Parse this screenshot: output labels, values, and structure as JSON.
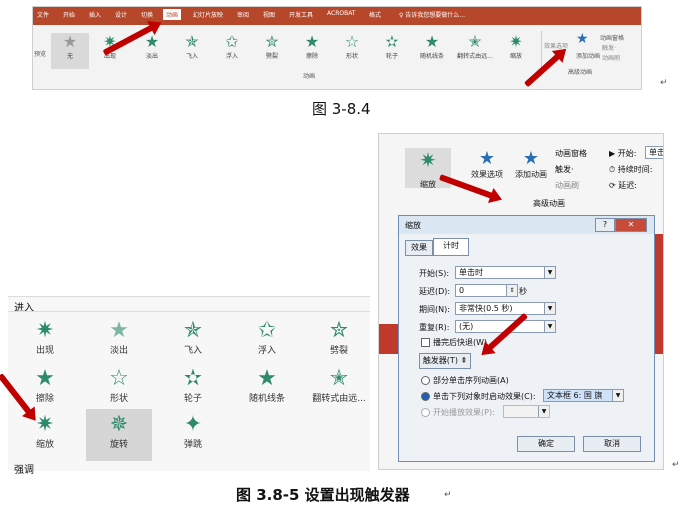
{
  "ribbon": {
    "tabs": [
      "文件",
      "开始",
      "插入",
      "设计",
      "切换",
      "动画",
      "幻灯片放映",
      "审阅",
      "视图",
      "开发工具",
      "ACROBAT",
      "格式",
      "♀ 告诉我您想要做什么..."
    ],
    "active_tab": "动画",
    "effects": [
      "无",
      "出现",
      "淡出",
      "飞入",
      "浮入",
      "劈裂",
      "擦除",
      "形状",
      "轮子",
      "随机线条",
      "翻转式由远...",
      "缩放"
    ],
    "left_label": "预览",
    "group_label": "动画",
    "right_items": [
      "效果选项",
      "添加动画",
      "动画窗格",
      "触发·",
      "动画刷"
    ],
    "right_group": "高级动画"
  },
  "caption1": "图 3-8.4",
  "caption2": "图 3.8-5 设置出现触发器",
  "para_mark": "↵",
  "panel": {
    "effect_label": "缩放",
    "effect_options": "效果选项",
    "add_animation": "添加动画",
    "animation_pane": "动画窗格",
    "trigger": "触发·",
    "painter": "动画刷",
    "group": "高级动画",
    "start_label": "▶ 开始:",
    "start_val": "单击时",
    "duration_label": "⏱ 持续时间:",
    "delay_label": "⟳ 延迟:"
  },
  "dialog": {
    "title": "缩放",
    "help": "?",
    "close": "✕",
    "tabs": [
      "效果",
      "计时"
    ],
    "start_label": "开始(S):",
    "start_value": "单击时",
    "delay_label": "延迟(D):",
    "delay_value": "0",
    "delay_unit": "秒",
    "period_label": "期间(N):",
    "period_value": "非常快(0.5 秒)",
    "repeat_label": "重复(R):",
    "repeat_value": "(无)",
    "rewind_label": "播完后快退(W)",
    "trigger_button": "触发器(T) ⇞",
    "radio1": "部分单击序列动画(A)",
    "radio2": "单击下列对象时启动效果(C):",
    "radio2_value": "文本框 6: 国 旗",
    "radio3": "开始播放效果(P):",
    "ok": "确定",
    "cancel": "取消"
  },
  "gallery": {
    "section": "进入",
    "section2": "强调",
    "items": [
      "出现",
      "淡出",
      "飞入",
      "浮入",
      "劈裂",
      "擦除",
      "形状",
      "轮子",
      "随机线条",
      "翻转式由远...",
      "缩放",
      "旋转",
      "弹跳"
    ],
    "selected": "旋转"
  },
  "colors": {
    "accent": "#b7472a",
    "arrow": "#c00000",
    "icon": "#2e8a6c"
  }
}
